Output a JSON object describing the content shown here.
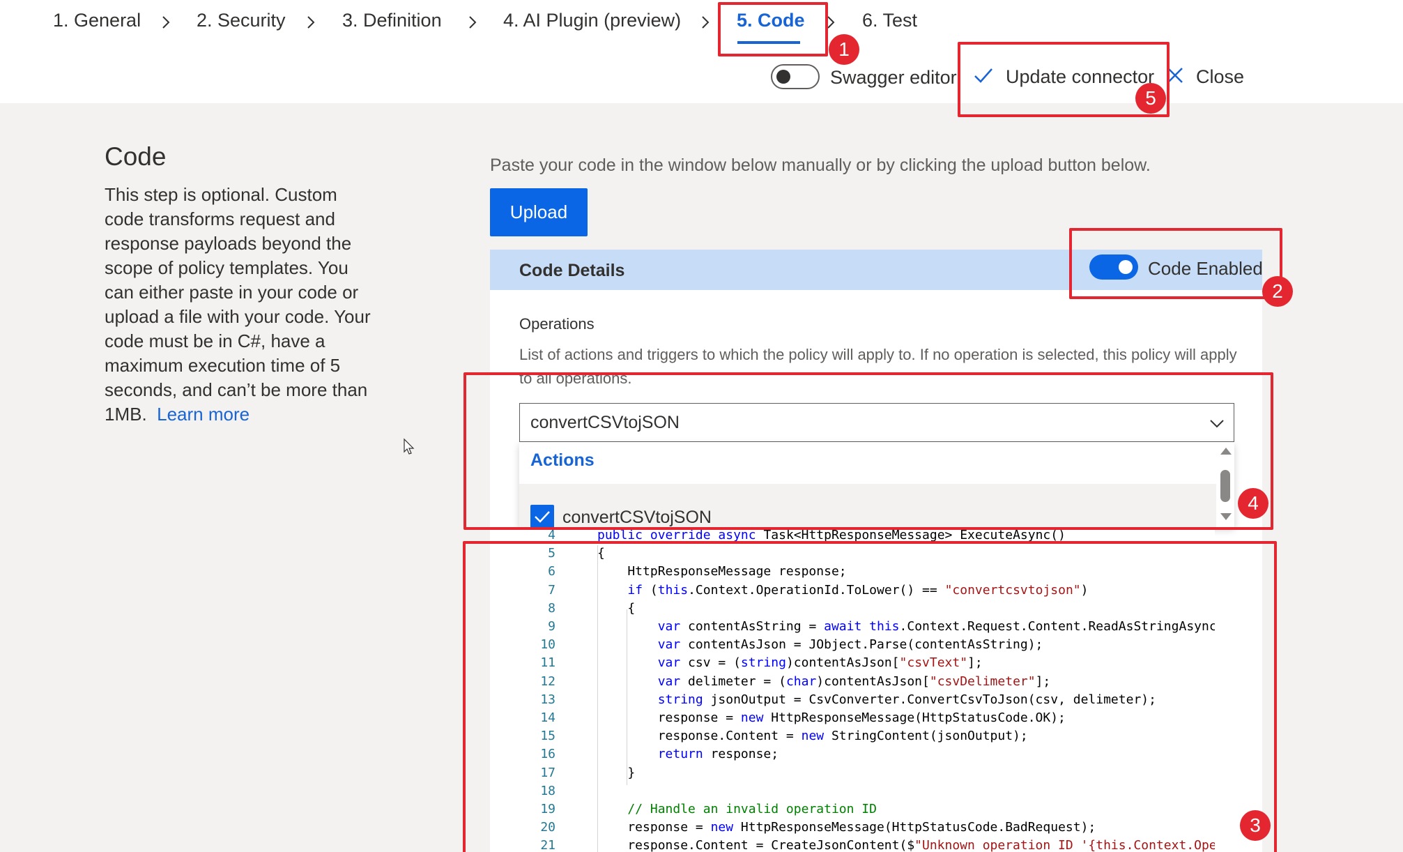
{
  "wizard": {
    "steps": [
      {
        "label": "1. General"
      },
      {
        "label": "2. Security"
      },
      {
        "label": "3. Definition"
      },
      {
        "label": "4. AI Plugin (preview)"
      },
      {
        "label": "5. Code",
        "active": true
      },
      {
        "label": "6. Test"
      }
    ]
  },
  "toolbar": {
    "swagger_label": "Swagger editor",
    "swagger_enabled": false,
    "update_label": "Update connector",
    "close_label": "Close"
  },
  "info": {
    "title": "Code",
    "description": "This step is optional. Custom code transforms request and response payloads beyond the scope of policy templates. You can either paste in your code or upload a file with your code. Your code must be in C#, have a maximum execution time of 5 seconds, and can’t be more than 1MB.",
    "learn_more": "Learn more"
  },
  "main": {
    "paste_hint": "Paste your code in the window below manually or by clicking the upload button below.",
    "upload_label": "Upload",
    "details_title": "Code Details",
    "code_enabled_label": "Code Enabled",
    "code_enabled": true,
    "operations_label": "Operations",
    "operations_help": "List of actions and triggers to which the policy will apply to. If no operation is selected, this policy will apply to all operations.",
    "selected_operation": "convertCSVtojSON",
    "dropdown_group": "Actions",
    "dropdown_item": "convertCSVtojSON",
    "dropdown_item_checked": true
  },
  "editor": {
    "lines": [
      {
        "n": "4",
        "code": "public override async Task<HttpResponseMessage> ExecuteAsync()"
      },
      {
        "n": "5",
        "code": "{"
      },
      {
        "n": "6",
        "code": "    HttpResponseMessage response;"
      },
      {
        "n": "7",
        "code": "    if (this.Context.OperationId.ToLower() == \"convertcsvtojson\")"
      },
      {
        "n": "8",
        "code": "    {"
      },
      {
        "n": "9",
        "code": "        var contentAsString = await this.Context.Request.Content.ReadAsStringAsync().C"
      },
      {
        "n": "10",
        "code": "        var contentAsJson = JObject.Parse(contentAsString);"
      },
      {
        "n": "11",
        "code": "        var csv = (string)contentAsJson[\"csvText\"];"
      },
      {
        "n": "12",
        "code": "        var delimeter = (char)contentAsJson[\"csvDelimeter\"];"
      },
      {
        "n": "13",
        "code": "        string jsonOutput = CsvConverter.ConvertCsvToJson(csv, delimeter);"
      },
      {
        "n": "14",
        "code": "        response = new HttpResponseMessage(HttpStatusCode.OK);"
      },
      {
        "n": "15",
        "code": "        response.Content = new StringContent(jsonOutput);"
      },
      {
        "n": "16",
        "code": "        return response;"
      },
      {
        "n": "17",
        "code": "    }"
      },
      {
        "n": "18",
        "code": ""
      },
      {
        "n": "19",
        "code": "    // Handle an invalid operation ID"
      },
      {
        "n": "20",
        "code": "    response = new HttpResponseMessage(HttpStatusCode.BadRequest);"
      },
      {
        "n": "21",
        "code": "    response.Content = CreateJsonContent($\"Unknown operation ID '{this.Context.Operati"
      }
    ]
  },
  "annotations": {
    "badges": [
      "1",
      "2",
      "3",
      "4",
      "5"
    ],
    "color": "#e3262f"
  },
  "colors": {
    "accent": "#1864d4",
    "primary_button": "#0a66e4",
    "details_header": "#c7dcf6"
  }
}
